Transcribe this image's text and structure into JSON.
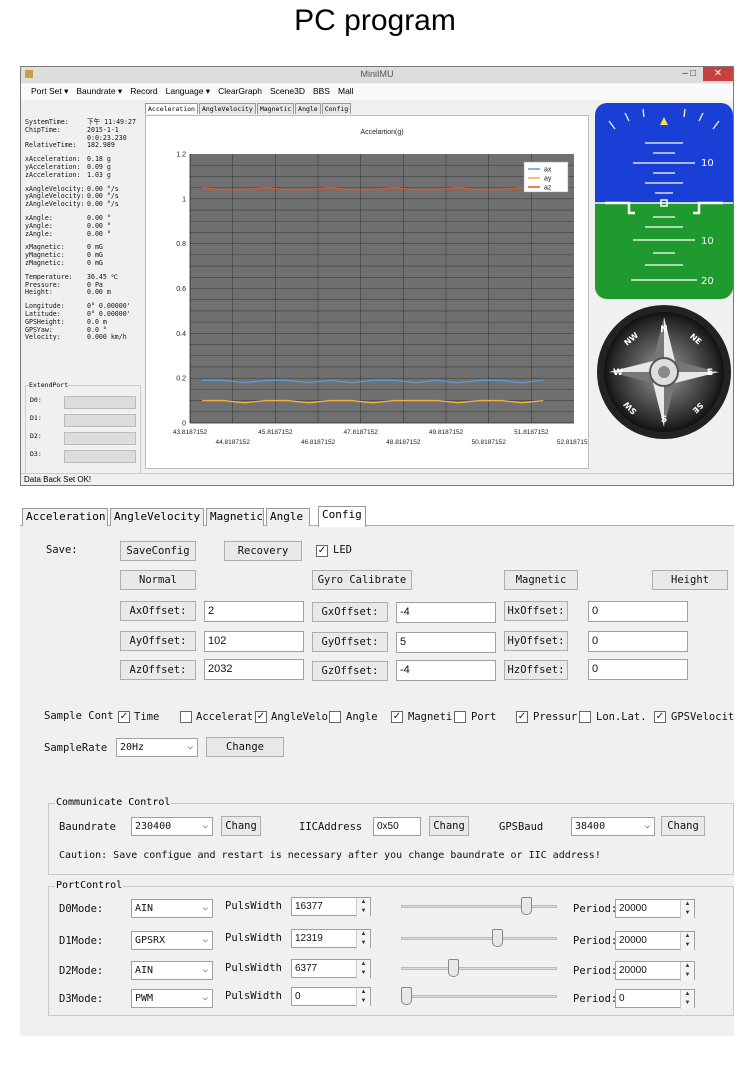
{
  "heading": "PC program",
  "window": {
    "title": "MiniIMU",
    "controls": {
      "minimize": "–",
      "maximize": "□",
      "close": "✕"
    },
    "menu": [
      "Port Set ▾",
      "Baundrate ▾",
      "Record",
      "Language ▾",
      "ClearGraph",
      "Scene3D",
      "BBS",
      "Mall"
    ],
    "status": "Data Back Set OK!"
  },
  "readings": [
    {
      "k": "SystemTime:",
      "v": "下午 11:49:27"
    },
    {
      "k": "ChipTime:",
      "v": "2015-1-1"
    },
    {
      "k": "",
      "v": "0:0:23.230"
    },
    {
      "k": "RelativeTime:",
      "v": "182.989"
    },
    {
      "gap": true
    },
    {
      "k": "xAcceleration:",
      "v": "0.18 g"
    },
    {
      "k": "yAcceleration:",
      "v": "0.09 g"
    },
    {
      "k": "zAcceleration:",
      "v": "1.03 g"
    },
    {
      "gap": true
    },
    {
      "k": "xAngleVelocity:",
      "v": "0.00 °/s"
    },
    {
      "k": "yAngleVelocity:",
      "v": "0.00 °/s"
    },
    {
      "k": "zAngleVelocity:",
      "v": "0.00 °/s"
    },
    {
      "gap": true
    },
    {
      "k": "xAngle:",
      "v": "0.00 °"
    },
    {
      "k": "yAngle:",
      "v": "0.00 °"
    },
    {
      "k": "zAngle:",
      "v": "0.00 °"
    },
    {
      "gap": true
    },
    {
      "k": "xMagnetic:",
      "v": "0 mG"
    },
    {
      "k": "yMagnetic:",
      "v": "0 mG"
    },
    {
      "k": "zMagnetic:",
      "v": "0 mG"
    },
    {
      "gap": true
    },
    {
      "k": "Temperature:",
      "v": "36.45 ℃"
    },
    {
      "k": "Pressure:",
      "v": "0 Pa"
    },
    {
      "k": "Height:",
      "v": "0.00 m"
    },
    {
      "gap": true
    },
    {
      "k": "Longitude:",
      "v": "0° 0.00000'"
    },
    {
      "k": "Latitude:",
      "v": "0° 0.00000'"
    },
    {
      "k": "GPSHeight:",
      "v": "0.0 m"
    },
    {
      "k": "GPSYaw:",
      "v": "0.0 °"
    },
    {
      "k": "Velocity:",
      "v": "0.000 km/h"
    }
  ],
  "extend_port": {
    "label": "ExtendPort",
    "ports": [
      "D0:",
      "D1:",
      "D2:",
      "D3:"
    ]
  },
  "chart_tabs": [
    "Acceleration",
    "AngleVelocity",
    "Magnetic",
    "Angle",
    "Config"
  ],
  "horizon": {
    "labels": [
      "10",
      "10",
      "10",
      "20"
    ]
  },
  "compass": {
    "letters": [
      "N",
      "E",
      "S",
      "W",
      "NE",
      "SE",
      "SW",
      "NW"
    ]
  },
  "chart_data": {
    "type": "line",
    "title": "Accelartion(g)",
    "xlabel": "",
    "ylabel": "",
    "xlim": [
      43.8187152,
      52.8187152
    ],
    "ylim": [
      0,
      1.2
    ],
    "yticks": [
      "0",
      "0.2",
      "0.4",
      "0.6",
      "0.8",
      "1",
      "1.2"
    ],
    "xticks_upper": [
      "43.8187152",
      "45.8187152",
      "47.8187152",
      "49.8187152",
      "51.8187152"
    ],
    "xticks_lower": [
      "44.8187152",
      "46.8187152",
      "48.8187152",
      "50.8187152",
      "52.8187152"
    ],
    "legend_position": "top-right",
    "grid": true,
    "background": "#707070",
    "x": [
      44.1,
      44.6,
      45.1,
      45.6,
      46.1,
      46.6,
      47.1,
      47.6,
      48.1,
      48.6,
      49.1,
      49.6,
      50.1,
      50.6,
      51.1,
      51.6,
      52.1
    ],
    "series": [
      {
        "name": "ax",
        "color": "#5b9bd5",
        "values": [
          0.19,
          0.19,
          0.18,
          0.19,
          0.19,
          0.18,
          0.19,
          0.18,
          0.19,
          0.19,
          0.18,
          0.19,
          0.18,
          0.19,
          0.19,
          0.18,
          0.19
        ]
      },
      {
        "name": "ay",
        "color": "#f0b040",
        "values": [
          0.1,
          0.1,
          0.09,
          0.1,
          0.1,
          0.09,
          0.1,
          0.1,
          0.09,
          0.1,
          0.1,
          0.1,
          0.09,
          0.1,
          0.1,
          0.09,
          0.1
        ]
      },
      {
        "name": "az",
        "color": "#e0552a",
        "values": [
          1.05,
          1.04,
          1.04,
          1.05,
          1.04,
          1.04,
          1.05,
          1.04,
          1.04,
          1.05,
          1.04,
          1.04,
          1.05,
          1.04,
          1.04,
          1.05,
          1.04
        ]
      }
    ]
  },
  "config": {
    "tabs": [
      "Acceleration",
      "AngleVelocity",
      "Magnetic",
      "Angle",
      "Config"
    ],
    "save_label": "Save:",
    "save_config": "SaveConfig",
    "recovery": "Recovery",
    "led": "LED",
    "normal": "Normal",
    "gyro_calibrate": "Gyro Calibrate",
    "magnetic": "Magnetic",
    "height": "Height",
    "offsets": {
      "ax_label": "AxOffset:",
      "ax": "2",
      "ay_label": "AyOffset:",
      "ay": "102",
      "az_label": "AzOffset:",
      "az": "2032",
      "gx_label": "GxOffset:",
      "gx": "-4",
      "gy_label": "GyOffset:",
      "gy": "5",
      "gz_label": "GzOffset:",
      "gz": "-4",
      "hx_label": "HxOffset:",
      "hx": "0",
      "hy_label": "HyOffset:",
      "hy": "0",
      "hz_label": "HzOffset:",
      "hz": "0"
    },
    "sample_label": "Sample Cont",
    "sample_items": [
      {
        "label": "Time",
        "checked": "✓"
      },
      {
        "label": "Accelerat",
        "checked": ""
      },
      {
        "label": "AngleVelo",
        "checked": "✓"
      },
      {
        "label": "Angle",
        "checked": ""
      },
      {
        "label": "Magneti",
        "checked": "✓"
      },
      {
        "label": "Port",
        "checked": ""
      },
      {
        "label": "Pressur",
        "checked": "✓"
      },
      {
        "label": "Lon.Lat.",
        "checked": ""
      },
      {
        "label": "GPSVelocit",
        "checked": "✓"
      }
    ],
    "sample_rate_label": "SampleRate",
    "sample_rate": "20Hz",
    "change": "Change",
    "comm": {
      "title": "Communicate Control",
      "baud_label": "Baundrate",
      "baud": "230400",
      "iic_label": "IICAddress",
      "iic": "0x50",
      "gps_label": "GPSBaud",
      "gps": "38400",
      "chang": "Chang",
      "caution": "Caution: Save configue and restart is necessary after you change baundrate or IIC address!"
    },
    "port": {
      "title": "PortControl",
      "rows": [
        {
          "label": "D0Mode:",
          "mode": "AIN",
          "pw_label": "PulsWidth",
          "pw": "16377",
          "period_label": "Period:",
          "period": "20000",
          "level": 0.82
        },
        {
          "label": "D1Mode:",
          "mode": "GPSRX",
          "pw_label": "PulsWidth",
          "pw": "12319",
          "period_label": "Period:",
          "period": "20000",
          "level": 0.62
        },
        {
          "label": "D2Mode:",
          "mode": "AIN",
          "pw_label": "PulsWidth",
          "pw": "6377",
          "period_label": "Period:",
          "period": "20000",
          "level": 0.32
        },
        {
          "label": "D3Mode:",
          "mode": "PWM",
          "pw_label": "PulsWidth",
          "pw": "0",
          "period_label": "Period:",
          "period": "0",
          "level": 0.0
        }
      ]
    }
  }
}
